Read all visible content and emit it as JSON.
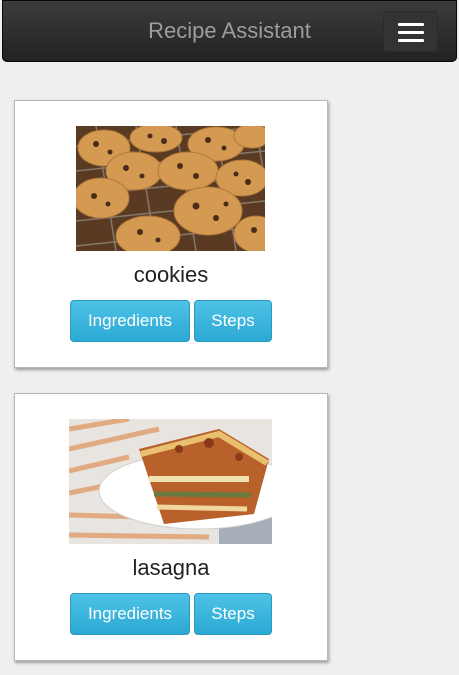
{
  "header": {
    "title": "Recipe Assistant",
    "menu_icon": "hamburger-menu-icon"
  },
  "recipes": [
    {
      "name": "cookies",
      "image": "chocolate-chip-cookies-photo",
      "ingredients_label": "Ingredients",
      "steps_label": "Steps"
    },
    {
      "name": "lasagna",
      "image": "lasagna-photo",
      "ingredients_label": "Ingredients",
      "steps_label": "Steps"
    }
  ],
  "colors": {
    "navbar": "#222222",
    "brand_text": "#9d9d9d",
    "button": "#31b0d5",
    "background": "#efefef"
  }
}
